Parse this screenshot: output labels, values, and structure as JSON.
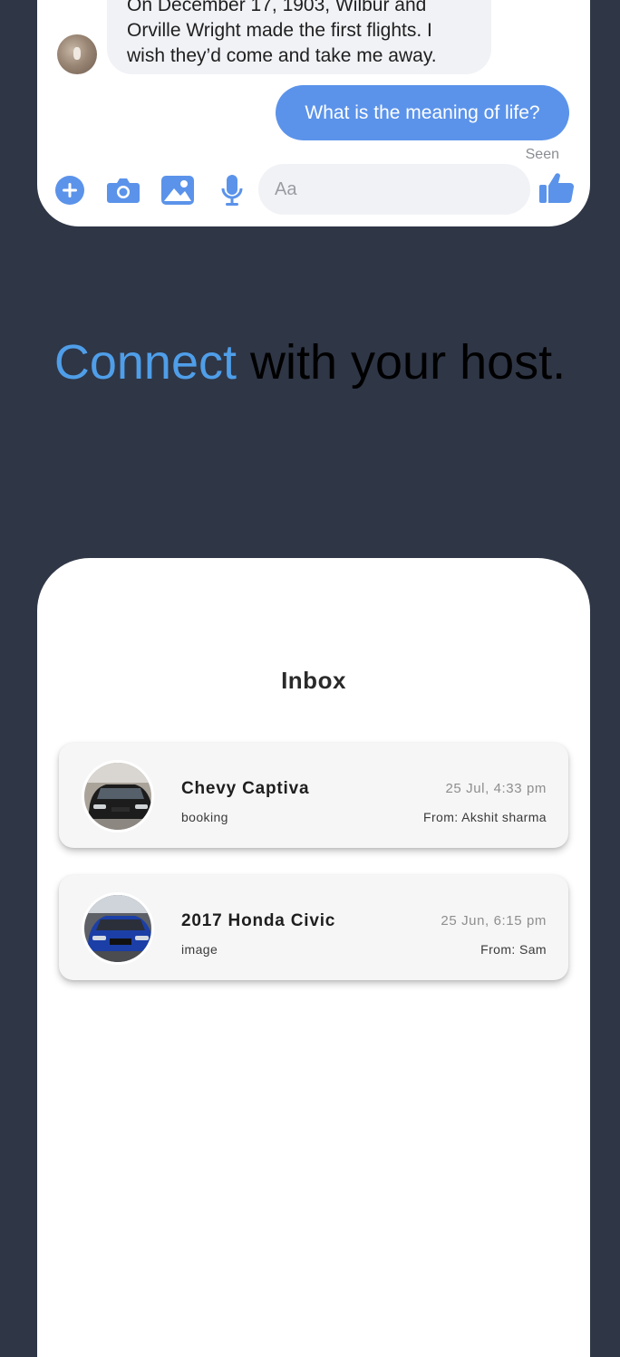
{
  "chat": {
    "incoming_text": "On December 17, 1903, Wilbur and Orville Wright made the first flights. I wish they’d come and take me away.",
    "outgoing_text": "What is the meaning of life?",
    "seen_label": "Seen",
    "input_placeholder": "Aa",
    "icons": [
      "plus-circle-icon",
      "camera-icon",
      "image-icon",
      "microphone-icon",
      "thumbs-up-icon"
    ],
    "accent_color": "#5b93ea"
  },
  "headline": {
    "accent_word": "Connect",
    "rest": " with your host.",
    "accent_color": "#4f9ee9"
  },
  "inbox": {
    "title": "Inbox",
    "threads": [
      {
        "title": "Chevy Captiva",
        "subtitle": "booking",
        "date": "25 Jul, 4:33 pm",
        "from": "From: Akshit sharma",
        "avatar_color": "#1c1c1c"
      },
      {
        "title": "2017 Honda Civic",
        "subtitle": "image",
        "date": "25 Jun, 6:15 pm",
        "from": "From: Sam",
        "avatar_color": "#1b3fa6"
      }
    ]
  },
  "colors": {
    "background": "#2f3646",
    "card": "#ffffff"
  }
}
